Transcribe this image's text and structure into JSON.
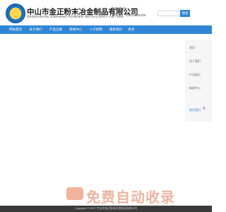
{
  "header": {
    "logo_text": "",
    "company_cn": "中山市金正粉末冶金制品有限公司",
    "company_en": "ZHONGSHAN JINZHENG POWDER METALLURGY CO., LTD.",
    "contact": {
      "label": "联系方式：",
      "phone": "13902658258",
      "person": "贾先生："
    },
    "search": {
      "placeholder": "",
      "button_label": "搜索"
    }
  },
  "nav": {
    "items": [
      "网站首页",
      "关于我们",
      "产品分类",
      "新闻中心",
      "人才招聘",
      "联系我们"
    ],
    "more_label": "更多"
  },
  "sidebar": {
    "items": [
      "首页",
      "关于我们",
      "产品展示",
      "新闻中心",
      "联系我们"
    ],
    "active_index": 4
  },
  "watermark": {
    "text": "免费自动收录"
  },
  "footer": {
    "text": "Copyright © 2017 中山市金正粉末冶金制品有限公司"
  },
  "colors": {
    "nav_bg": "#2f86d6",
    "footer_bg": "#3a3a3a",
    "watermark": "#e8aa92"
  }
}
